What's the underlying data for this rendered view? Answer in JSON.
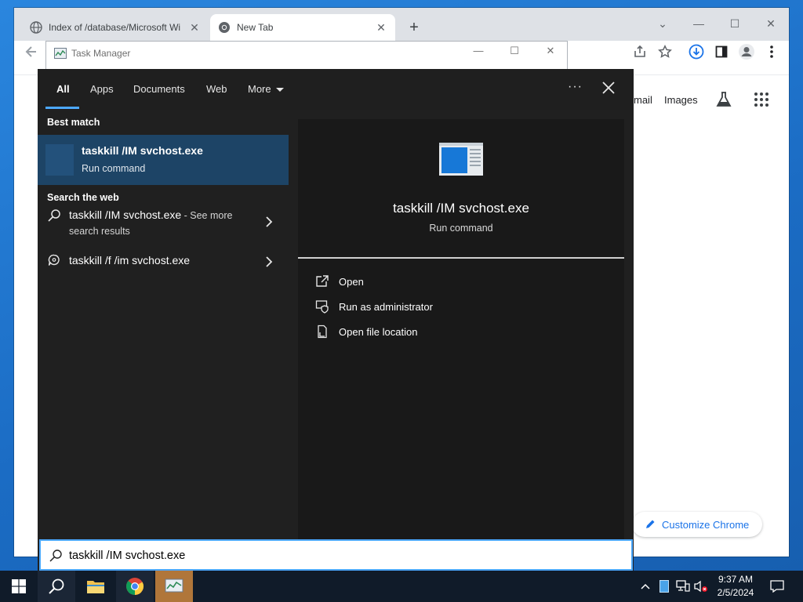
{
  "chrome": {
    "tabs": [
      {
        "title": "Index of /database/Microsoft Wi",
        "active": false
      },
      {
        "title": "New Tab",
        "active": true
      }
    ],
    "ntp": {
      "gmail_label": "mail",
      "images_label": "Images",
      "customize_label": "Customize Chrome"
    }
  },
  "taskmgr": {
    "title": "Task Manager"
  },
  "search_panel": {
    "tabs": [
      "All",
      "Apps",
      "Documents",
      "Web",
      "More"
    ],
    "active_tab": "All",
    "best_match_heading": "Best match",
    "best_match": {
      "title": "taskkill /IM svchost.exe",
      "subtitle": "Run command"
    },
    "search_web_heading": "Search the web",
    "web_results": [
      {
        "text": "taskkill /IM svchost.exe",
        "suffix": " - See more",
        "line2": "search results"
      },
      {
        "text": "taskkill /f /im svchost.exe"
      }
    ],
    "preview": {
      "title": "taskkill /IM svchost.exe",
      "subtitle": "Run command"
    },
    "actions": [
      {
        "label": "Open",
        "icon": "open-icon"
      },
      {
        "label": "Run as administrator",
        "icon": "shield-icon"
      },
      {
        "label": "Open file location",
        "icon": "file-location-icon"
      }
    ],
    "query": "taskkill /IM svchost.exe"
  },
  "taskbar": {
    "pinned": [
      "start-icon",
      "search-icon",
      "file-explorer-icon",
      "chrome-icon",
      "task-manager-icon"
    ],
    "clock": {
      "time": "9:37 AM",
      "date": "2/5/2024"
    }
  },
  "colors": {
    "accent": "#4ca8ff",
    "best_match_bg": "#1d4466",
    "panel_bg": "#202020",
    "taskbar_bg": "#101b29"
  }
}
